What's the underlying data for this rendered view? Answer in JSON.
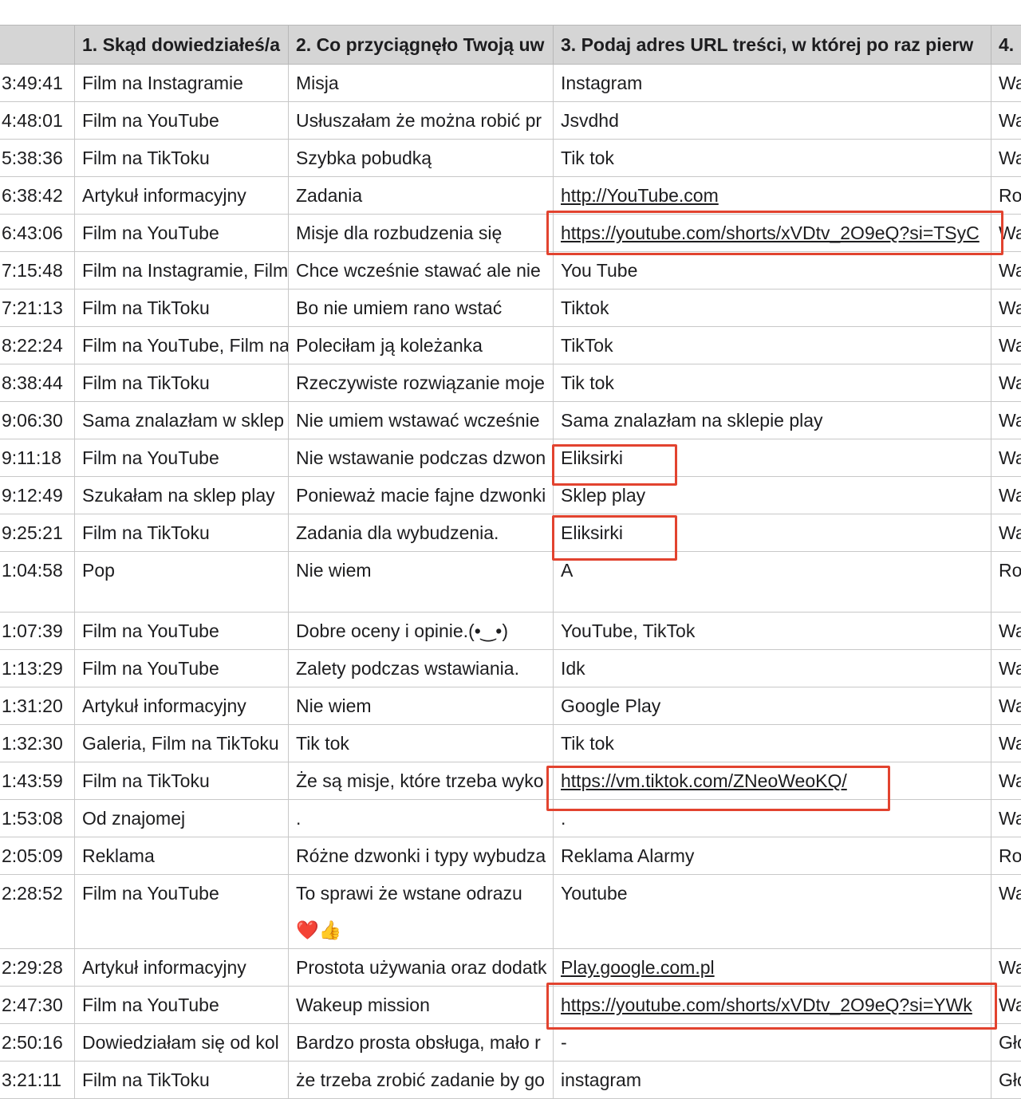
{
  "headers": [
    "",
    "1. Skąd dowiedziałeś/a",
    "2. Co przyciągnęło Twoją uw",
    "3. Podaj adres URL treści, w której po raz pierw",
    "4."
  ],
  "rows": [
    {
      "time": "3:49:41",
      "source": "Film na Instagramie",
      "reason": "Misja",
      "url": "Instagram",
      "col4": "Wa"
    },
    {
      "time": "4:48:01",
      "source": "Film na YouTube",
      "reason": "Usłuszałam że można robić pr",
      "url": "Jsvdhd",
      "col4": "Wa"
    },
    {
      "time": "5:38:36",
      "source": "Film na TikToku",
      "reason": "Szybka pobudką",
      "url": "Tik tok",
      "col4": "Wa"
    },
    {
      "time": "6:38:42",
      "source": "Artykuł informacyjny",
      "reason": "Zadania",
      "url": "http://YouTube.com",
      "col4": "Ro"
    },
    {
      "time": "6:43:06",
      "source": "Film na YouTube",
      "reason": "Misje dla rozbudzenia się",
      "url": "https://youtube.com/shorts/xVDtv_2O9eQ?si=TSyC",
      "col4": "Wa"
    },
    {
      "time": "7:15:48",
      "source": "Film na Instagramie, Film",
      "reason": "Chce wcześnie stawać ale nie",
      "url": "You Tube",
      "col4": "Wa"
    },
    {
      "time": "7:21:13",
      "source": "Film na TikToku",
      "reason": "Bo nie umiem rano wstać",
      "url": "Tiktok",
      "col4": "Wa"
    },
    {
      "time": "8:22:24",
      "source": "Film na YouTube, Film na",
      "reason": "Poleciłam ją koleżanka",
      "url": "TikTok",
      "col4": "Wa"
    },
    {
      "time": "8:38:44",
      "source": "Film na TikToku",
      "reason": "Rzeczywiste rozwiązanie moje",
      "url": "Tik tok",
      "col4": "Wa"
    },
    {
      "time": "9:06:30",
      "source": "Sama znalazłam w sklep",
      "reason": "Nie umiem wstawać wcześnie",
      "url": "Sama znalazłam na sklepie play",
      "col4": "Wa"
    },
    {
      "time": "9:11:18",
      "source": "Film na YouTube",
      "reason": "Nie wstawanie podczas dzwon",
      "url": "Eliksirki",
      "col4": "Wa"
    },
    {
      "time": "9:12:49",
      "source": "Szukałam na sklep play",
      "reason": "Ponieważ macie fajne dzwonki",
      "url": "Sklep play",
      "col4": "Wa"
    },
    {
      "time": "9:25:21",
      "source": "Film na TikToku",
      "reason": "Zadania dla wybudzenia.",
      "url": "Eliksirki",
      "col4": "Wa"
    },
    {
      "time": "1:04:58",
      "source": "Pop",
      "reason": "Nie wiem",
      "url": "A",
      "col4": "Ro"
    },
    {
      "time": "1:07:39",
      "source": "Film na YouTube",
      "reason": "Dobre oceny i opinie.(•‿•)",
      "url": "YouTube, TikTok",
      "col4": "Wa"
    },
    {
      "time": "1:13:29",
      "source": "Film na YouTube",
      "reason": "Zalety podczas wstawiania.",
      "url": "Idk",
      "col4": "Wa"
    },
    {
      "time": "1:31:20",
      "source": "Artykuł informacyjny",
      "reason": "Nie wiem",
      "url": "Google Play",
      "col4": "Wa"
    },
    {
      "time": "1:32:30",
      "source": "Galeria, Film na TikToku",
      "reason": "Tik tok",
      "url": "Tik tok",
      "col4": "Wa"
    },
    {
      "time": "1:43:59",
      "source": "Film na TikToku",
      "reason": "Że są misje, które trzeba wyko",
      "url": "https://vm.tiktok.com/ZNeoWeoKQ/",
      "col4": "Wa"
    },
    {
      "time": "1:53:08",
      "source": "Od znajomej",
      "reason": ".",
      "url": ".",
      "col4": "Wa"
    },
    {
      "time": "2:05:09",
      "source": "Reklama",
      "reason": "Różne dzwonki i typy wybudza",
      "url": "Reklama Alarmy",
      "col4": "Ro"
    },
    {
      "time": "2:28:52",
      "source": "Film na YouTube",
      "reason": "To sprawi że wstane odrazu",
      "reason_emoji": "❤️👍",
      "url": "Youtube",
      "col4": "Wa"
    },
    {
      "time": "2:29:28",
      "source": "Artykuł informacyjny",
      "reason": "Prostota używania oraz dodatk",
      "url": "Play.google.com.pl",
      "col4": "Wa"
    },
    {
      "time": "2:47:30",
      "source": "Film na YouTube",
      "reason": "Wakeup mission",
      "url": "https://youtube.com/shorts/xVDtv_2O9eQ?si=YWk",
      "col4": "Wa"
    },
    {
      "time": "2:50:16",
      "source": "Dowiedziałam się od kol",
      "reason": "Bardzo prosta obsługa, mało r",
      "url": "-",
      "col4": "Gło"
    },
    {
      "time": "3:21:11",
      "source": "Film na TikToku",
      "reason": "że trzeba zrobić zadanie by go",
      "url": "instagram",
      "col4": "Gło"
    }
  ],
  "highlight_color": "#e2432f"
}
